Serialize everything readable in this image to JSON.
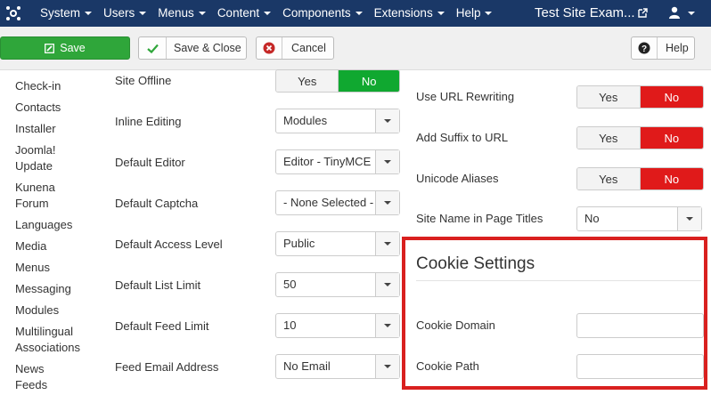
{
  "colors": {
    "nav_bg": "#1a3867",
    "save_green": "#2fa63a",
    "no_red": "#e01a1a",
    "no_green": "#10a830",
    "highlight_red": "#d9201f"
  },
  "nav": {
    "logo_icon": "joomla-logo-icon",
    "items": [
      "System",
      "Users",
      "Menus",
      "Content",
      "Components",
      "Extensions",
      "Help"
    ],
    "site_title": "Test Site Exam...",
    "external_icon": "external-link-icon",
    "user_icon": "user-icon"
  },
  "toolbar": {
    "save": "Save",
    "save_close": "Save & Close",
    "cancel": "Cancel",
    "help": "Help"
  },
  "sidebar": {
    "items": [
      "Check-in",
      "Contacts",
      "Installer",
      "Joomla!\nUpdate",
      "Kunena\nForum",
      "Languages",
      "Media",
      "Menus",
      "Messaging",
      "Modules",
      "Multilingual\nAssociations",
      "News\nFeeds"
    ]
  },
  "site": {
    "offline_label": "Site Offline",
    "offline_yes": "Yes",
    "offline_no": "No",
    "inline_label": "Inline Editing",
    "inline_value": "Modules",
    "editor_label": "Default Editor",
    "editor_value": "Editor - TinyMCE",
    "captcha_label": "Default Captcha",
    "captcha_value": "- None Selected -",
    "access_label": "Default Access Level",
    "access_value": "Public",
    "list_label": "Default List Limit",
    "list_value": "50",
    "feed_label": "Default Feed Limit",
    "feed_value": "10",
    "email_label": "Feed Email Address",
    "email_value": "No Email"
  },
  "seo": {
    "rewrite_label": "Use URL Rewriting",
    "suffix_label": "Add Suffix to URL",
    "unicode_label": "Unicode Aliases",
    "yes": "Yes",
    "no": "No",
    "sitename_label": "Site Name in Page Titles",
    "sitename_value": "No"
  },
  "cookie": {
    "title": "Cookie Settings",
    "domain_label": "Cookie Domain",
    "domain_value": "",
    "path_label": "Cookie Path",
    "path_value": ""
  }
}
